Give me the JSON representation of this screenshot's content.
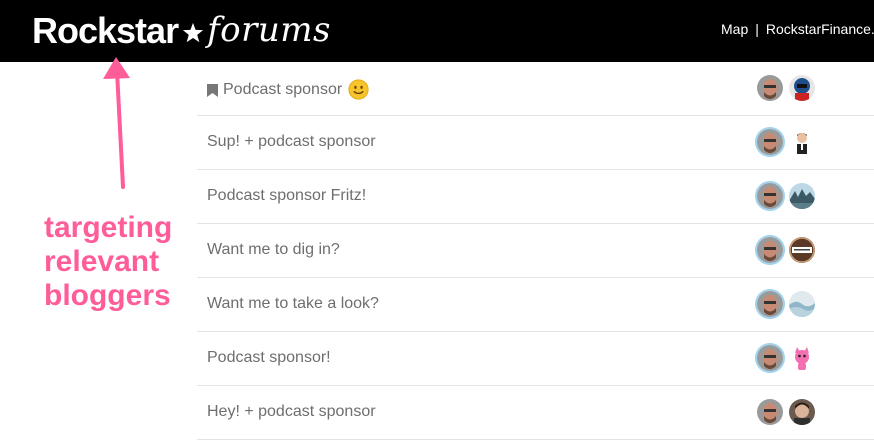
{
  "header": {
    "logo_main": "Rockstar",
    "logo_sub": "forums",
    "links": [
      {
        "label": "Map"
      },
      {
        "label": "RockstarFinance.c"
      }
    ],
    "separator": "|"
  },
  "topics": [
    {
      "title": "Podcast sponsor",
      "bookmarked": true,
      "emoji": "slightly-smiling-face"
    },
    {
      "title": "Sup! + podcast sponsor"
    },
    {
      "title": "Podcast sponsor Fritz!"
    },
    {
      "title": "Want me to dig in?"
    },
    {
      "title": "Want me to take a look?"
    },
    {
      "title": "Podcast sponsor!"
    },
    {
      "title": "Hey! + podcast sponsor"
    }
  ],
  "annotation": {
    "lines": [
      "targeting",
      "relevant",
      "bloggers"
    ]
  },
  "colors": {
    "header_bg": "#000000",
    "annotation": "#ff5c9a",
    "title_text": "#6e6e6e",
    "avatar_ring": "#9fd3ef"
  }
}
